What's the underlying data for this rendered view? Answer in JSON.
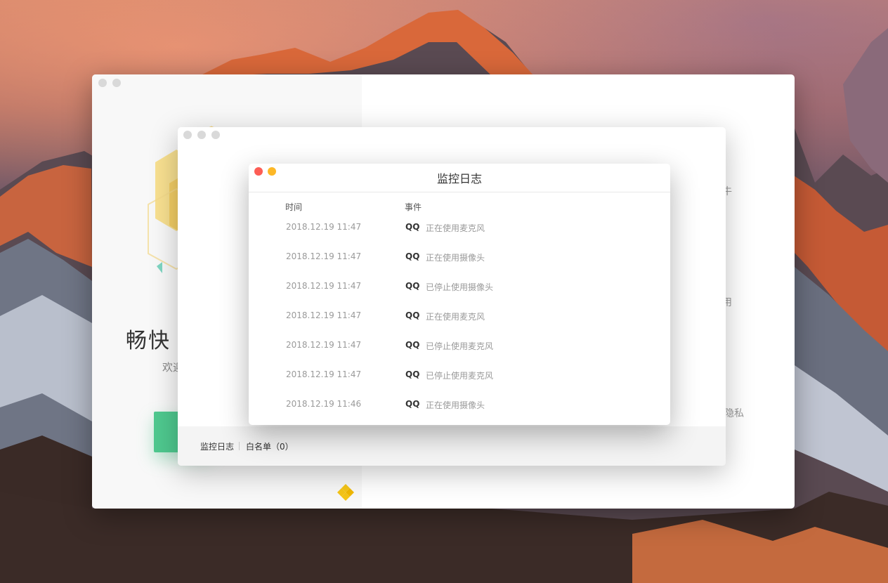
{
  "back_window": {
    "hero_title": "畅快",
    "hero_subtitle": "欢迎",
    "peek_texts": [
      "牛",
      "用",
      "私隐私"
    ]
  },
  "middle_window": {
    "footer_tabs": [
      {
        "label": "监控日志"
      },
      {
        "label": "白名单（0）"
      }
    ]
  },
  "log_dialog": {
    "title": "监控日志",
    "columns": {
      "time": "时间",
      "event": "事件"
    },
    "rows": [
      {
        "time": "2018.12.19  11:47",
        "app": "QQ",
        "event": "正在使用麦克风"
      },
      {
        "time": "2018.12.19  11:47",
        "app": "QQ",
        "event": "正在使用摄像头"
      },
      {
        "time": "2018.12.19  11:47",
        "app": "QQ",
        "event": "已停止使用摄像头"
      },
      {
        "time": "2018.12.19  11:47",
        "app": "QQ",
        "event": "正在使用麦克风"
      },
      {
        "time": "2018.12.19  11:47",
        "app": "QQ",
        "event": "已停止使用麦克风"
      },
      {
        "time": "2018.12.19  11:47",
        "app": "QQ",
        "event": "已停止使用麦克风"
      },
      {
        "time": "2018.12.19  11:46",
        "app": "QQ",
        "event": "正在使用摄像头"
      }
    ]
  },
  "colors": {
    "accent_green": "#4fc98f",
    "close_red": "#fd5d55",
    "minimize_yellow": "#fdb827",
    "logo_yellow": "#f5c518"
  }
}
